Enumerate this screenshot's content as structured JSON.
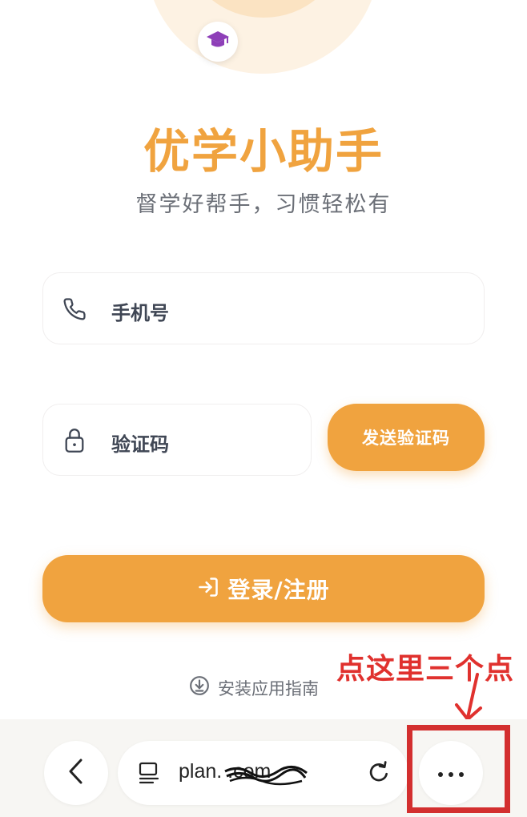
{
  "app": {
    "title": "优学小助手",
    "subtitle": "督学好帮手，习惯轻松有",
    "logo_icon": "graduation-cap-icon",
    "accent_color": "#f0a33f"
  },
  "form": {
    "phone_placeholder": "手机号",
    "phone_icon": "phone-icon",
    "code_placeholder": "验证码",
    "code_icon": "lock-icon",
    "send_code_label": "发送验证码",
    "login_label": "登录/注册",
    "login_icon": "login-arrow-icon"
  },
  "install_guide": {
    "label": "安装应用指南",
    "icon": "download-circle-icon"
  },
  "annotation": {
    "text": "点这里三个点",
    "color": "#e0312e"
  },
  "browser_bar": {
    "url": "plan.           .com",
    "back_icon": "chevron-left-icon",
    "page_icon": "page-icon",
    "reload_icon": "reload-icon",
    "more_icon": "more-dots-icon"
  }
}
